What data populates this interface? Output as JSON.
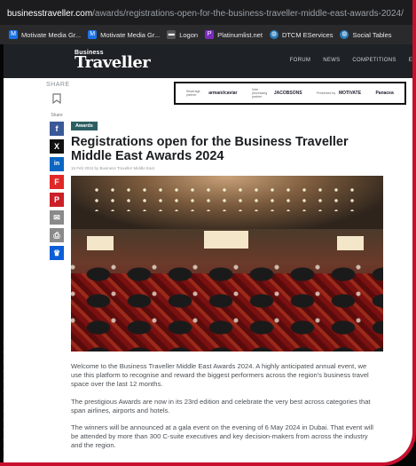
{
  "browser": {
    "url_host": "businesstraveller.com",
    "url_path": "/awards/registrations-open-for-the-business-traveller-middle-east-awards-2024/"
  },
  "bookmarks": [
    {
      "label": "Motivate Media Gr...",
      "icon": "motivate-icon",
      "color": "#1a73e8"
    },
    {
      "label": "Motivate Media Gr...",
      "icon": "motivate-icon",
      "color": "#1a73e8"
    },
    {
      "label": "Logon",
      "icon": "logon-icon",
      "color": "#555555"
    },
    {
      "label": "Platinumlist.net",
      "icon": "platinumlist-icon",
      "color": "#7b2cbf"
    },
    {
      "label": "DTCM EServices",
      "icon": "globe-icon",
      "color": "#2a7ab8"
    },
    {
      "label": "Social Tables",
      "icon": "social-tables-icon",
      "color": "#2a7ab8"
    }
  ],
  "site": {
    "logo_top": "Business",
    "logo_main": "Traveller",
    "nav": [
      "FORUM",
      "NEWS",
      "COMPETITIONS",
      "E"
    ]
  },
  "share": {
    "title": "SHARE",
    "small_label": "Share",
    "buttons": [
      {
        "glyph": "f",
        "icon": "facebook-icon",
        "color": "#3b5998"
      },
      {
        "glyph": "X",
        "icon": "x-icon",
        "color": "#111111"
      },
      {
        "glyph": "in",
        "icon": "linkedin-icon",
        "color": "#0a66c2"
      },
      {
        "glyph": "F",
        "icon": "flipboard-icon",
        "color": "#e12828"
      },
      {
        "glyph": "P",
        "icon": "pinterest-icon",
        "color": "#cb2027"
      },
      {
        "glyph": "✉",
        "icon": "email-icon",
        "color": "#8a8a8a"
      },
      {
        "glyph": "⎙",
        "icon": "print-icon",
        "color": "#8a8a8a"
      },
      {
        "glyph": "♛",
        "icon": "crown-icon",
        "color": "#0b5ed7"
      }
    ]
  },
  "sponsors": [
    {
      "label": "Beverage partner",
      "name": "armani/caviar"
    },
    {
      "label": "Vote processing partner",
      "name": "JACOBSONS"
    },
    {
      "label": "Presented by",
      "name": "MOTIVATE"
    },
    {
      "label": "",
      "name": "Panacea"
    }
  ],
  "article": {
    "tag": "Awards",
    "title": "Registrations open for the Business Traveller Middle East Awards 2024",
    "byline": "15 Feb 2024 by Business Traveller Middle East",
    "paragraphs": [
      "Welcome to the Business Traveller Middle East Awards 2024. A highly anticipated annual event, we use this platform to recognise and reward the biggest performers across the region's business travel space over the last 12 months.",
      "The prestigious Awards are now in its 23rd edition and celebrate the very best across categories that span airlines, airports and hotels.",
      "The winners will be announced at a gala event on the evening of 6 May 2024 in Dubai. That event will be attended by more than 300 C-suite executives and key decision-makers from across the industry and the region."
    ]
  }
}
